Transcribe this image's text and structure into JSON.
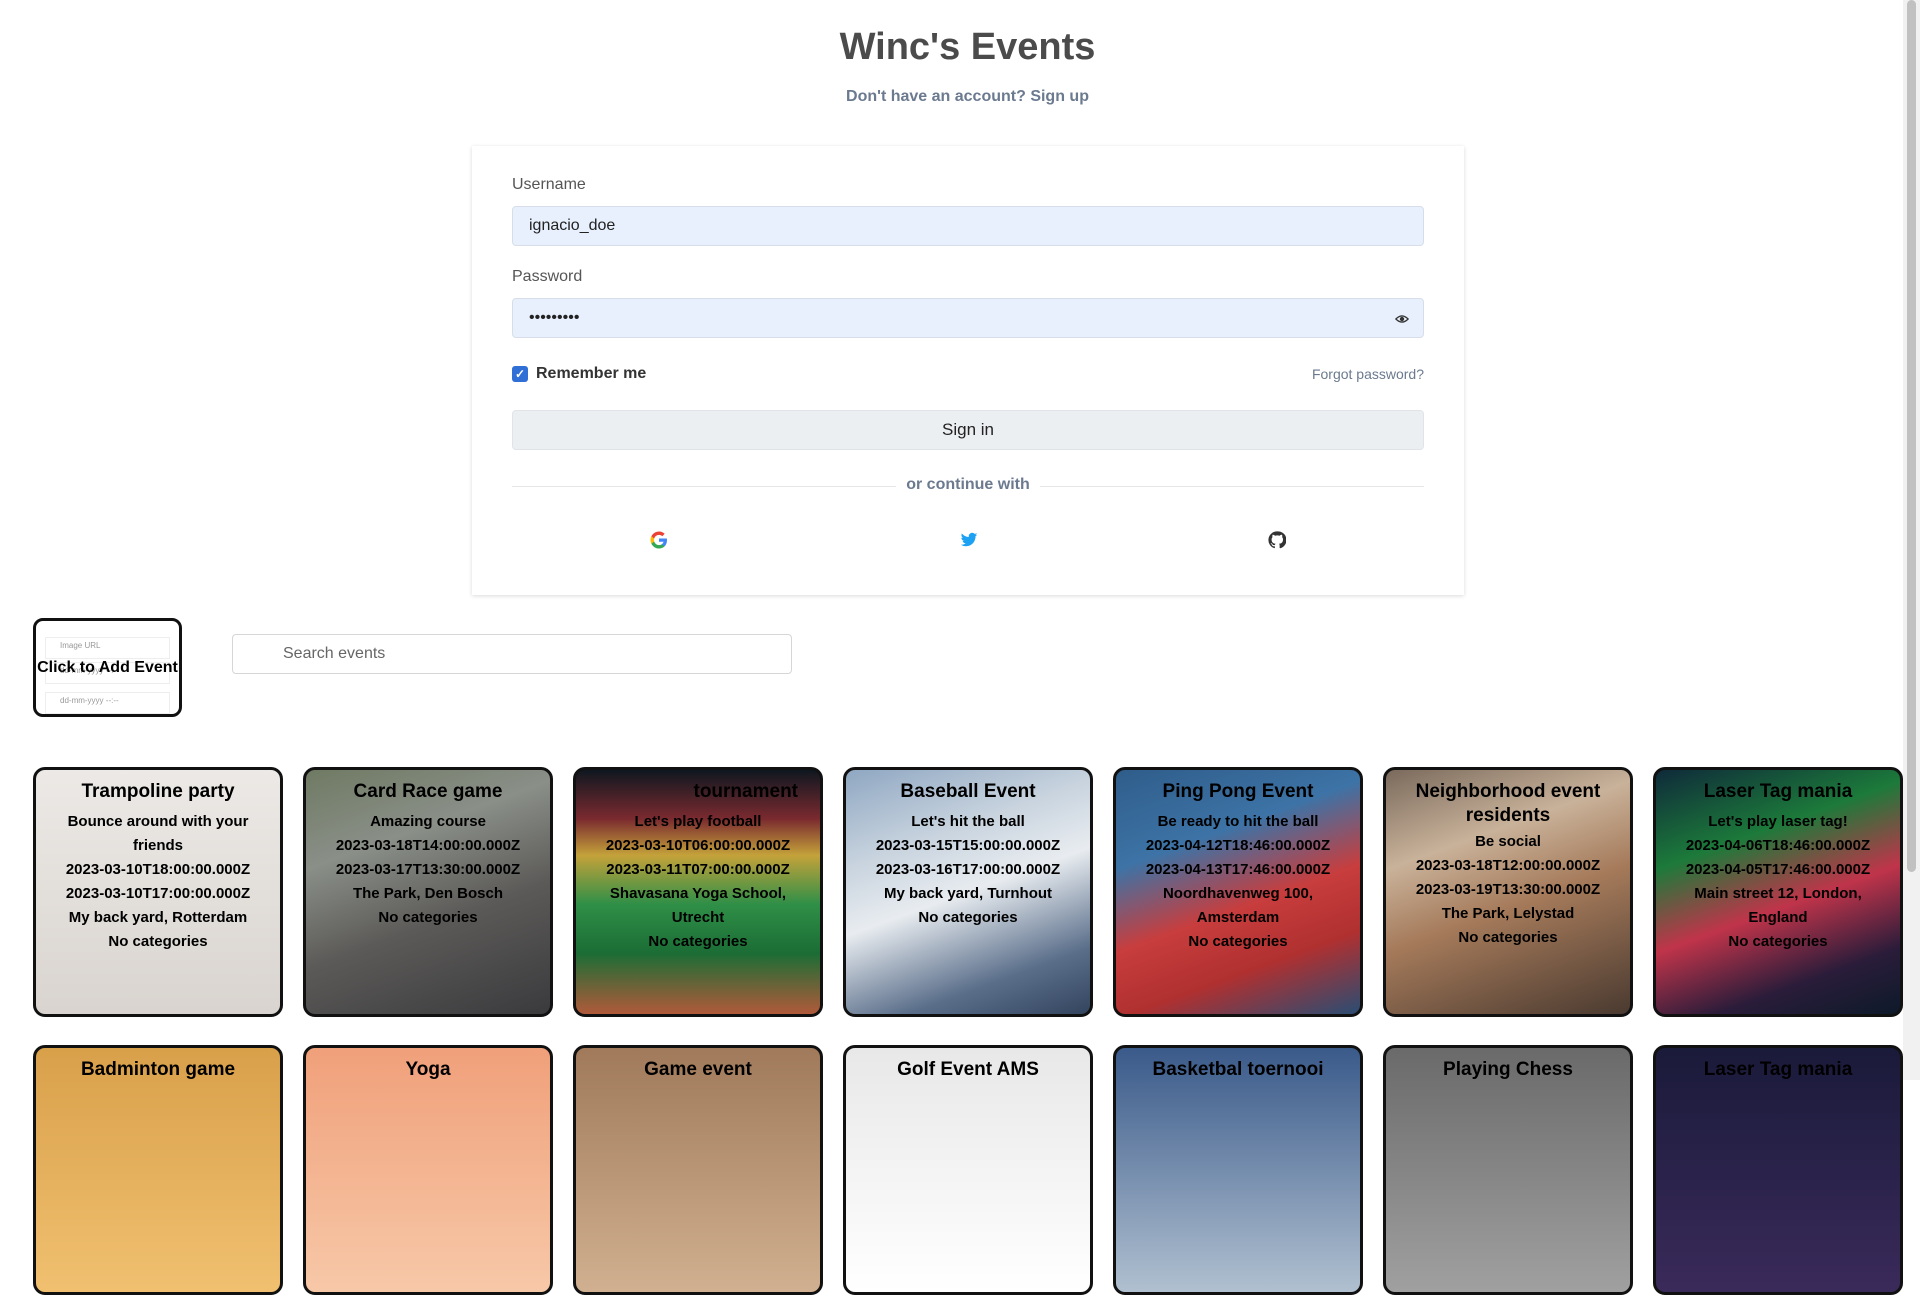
{
  "header": {
    "title": "Winc's Events",
    "signup_prompt": "Don't have an account?",
    "signup_link": "Sign up"
  },
  "login": {
    "username_label": "Username",
    "username_value": "ignacio_doe",
    "password_label": "Password",
    "password_value": "•••••••••",
    "remember_label": "Remember me",
    "remember_checked": true,
    "forgot_link": "Forgot password?",
    "signin_label": "Sign in",
    "divider_text": "or continue with",
    "social": [
      "google-icon",
      "twitter-icon",
      "github-icon"
    ]
  },
  "toolbar": {
    "add_event_label": "Click to Add Event",
    "add_event_ghost_image": "Image URL",
    "add_event_ghost_date": "dd-mm-yyyy --:--",
    "search_placeholder": "Search events"
  },
  "events": [
    {
      "name": "Trampoline party",
      "description": "Bounce around with your friends",
      "start": "2023-03-10T18:00:00.000Z",
      "end": "2023-03-10T17:00:00.000Z",
      "location": "My back yard, Rotterdam",
      "categories": "No categories"
    },
    {
      "name": "Card Race game",
      "description": "Amazing course",
      "start": "2023-03-18T14:00:00.000Z",
      "end": "2023-03-17T13:30:00.000Z",
      "location": "The Park, Den Bosch",
      "categories": "No categories"
    },
    {
      "name": "tournament",
      "description": "Let's play football",
      "start": "2023-03-10T06:00:00.000Z",
      "end": "2023-03-11T07:00:00.000Z",
      "location": "Shavasana Yoga School, Utrecht",
      "categories": "No categories"
    },
    {
      "name": "Baseball Event",
      "description": "Let's hit the ball",
      "start": "2023-03-15T15:00:00.000Z",
      "end": "2023-03-16T17:00:00.000Z",
      "location": "My back yard, Turnhout",
      "categories": "No categories"
    },
    {
      "name": "Ping Pong Event",
      "description": "Be ready to hit the ball",
      "start": "2023-04-12T18:46:00.000Z",
      "end": "2023-04-13T17:46:00.000Z",
      "location": "Noordhavenweg 100, Amsterdam",
      "categories": "No categories"
    },
    {
      "name": "Neighborhood event residents",
      "description": "Be social",
      "start": "2023-03-18T12:00:00.000Z",
      "end": "2023-03-19T13:30:00.000Z",
      "location": "The Park, Lelystad",
      "categories": "No categories"
    },
    {
      "name": "Laser Tag mania",
      "description": "Let's play laser tag!",
      "start": "2023-04-06T18:46:00.000Z",
      "end": "2023-04-05T17:46:00.000Z",
      "location": "Main street 12, London, England",
      "categories": "No categories"
    },
    {
      "name": "Badminton game"
    },
    {
      "name": "Yoga"
    },
    {
      "name": "Game event"
    },
    {
      "name": "Golf Event AMS"
    },
    {
      "name": "Basketbal toernooi"
    },
    {
      "name": "Playing Chess"
    },
    {
      "name": "Laser Tag mania"
    }
  ]
}
